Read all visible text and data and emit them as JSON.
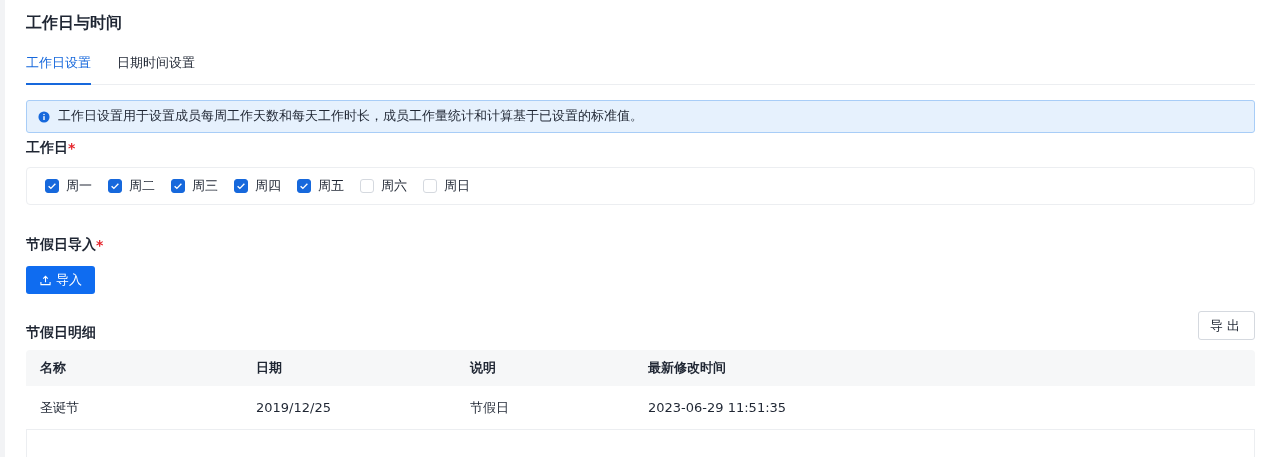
{
  "page": {
    "title": "工作日与时间"
  },
  "tabs": [
    {
      "label": "工作日设置",
      "selected": true
    },
    {
      "label": "日期时间设置",
      "selected": false
    }
  ],
  "info_alert": {
    "text": "工作日设置用于设置成员每周工作天数和每天工作时长，成员工作量统计和计算基于已设置的标准值。"
  },
  "workdays": {
    "label": "工作日",
    "required_mark": "*",
    "options": [
      {
        "label": "周一",
        "checked": true
      },
      {
        "label": "周二",
        "checked": true
      },
      {
        "label": "周三",
        "checked": true
      },
      {
        "label": "周四",
        "checked": true
      },
      {
        "label": "周五",
        "checked": true
      },
      {
        "label": "周六",
        "checked": false
      },
      {
        "label": "周日",
        "checked": false
      }
    ]
  },
  "holiday_import": {
    "label": "节假日导入",
    "required_mark": "*",
    "button": "导入"
  },
  "holiday_details": {
    "title": "节假日明细",
    "export_button": "导出",
    "table": {
      "columns": [
        "名称",
        "日期",
        "说明",
        "最新修改时间"
      ],
      "rows": [
        [
          "圣诞节",
          "2019/12/25",
          "节假日",
          "2023-06-29 11:51:35"
        ]
      ]
    }
  }
}
